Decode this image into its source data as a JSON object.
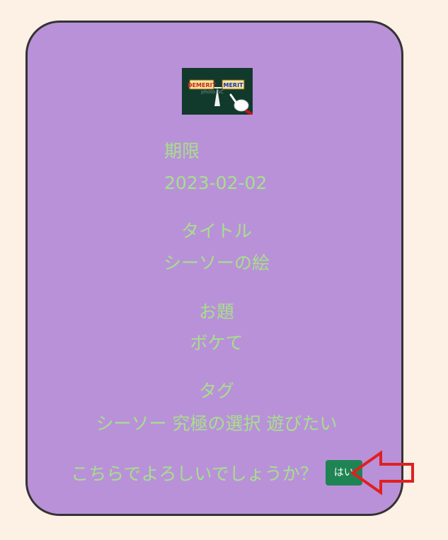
{
  "thumbnail": {
    "left_label": "DEMERIT",
    "right_label": "MERIT",
    "watermark": "photo AC"
  },
  "deadline": {
    "label": "期限",
    "value": "2023-02-02"
  },
  "title": {
    "label": "タイトル",
    "value": "シーソーの絵"
  },
  "topic": {
    "label": "お題",
    "value": "ボケて"
  },
  "tags": {
    "label": "タグ",
    "value": "シーソー 究極の選択 遊びたい"
  },
  "confirm": {
    "question": "こちらでよろしいでしょうか？",
    "yes_label": "はい"
  },
  "colors": {
    "page_background": "#fdf0e4",
    "card_background": "#b991d9",
    "text": "#a6e08a",
    "button": "#1e8453",
    "arrow": "#e02020"
  }
}
